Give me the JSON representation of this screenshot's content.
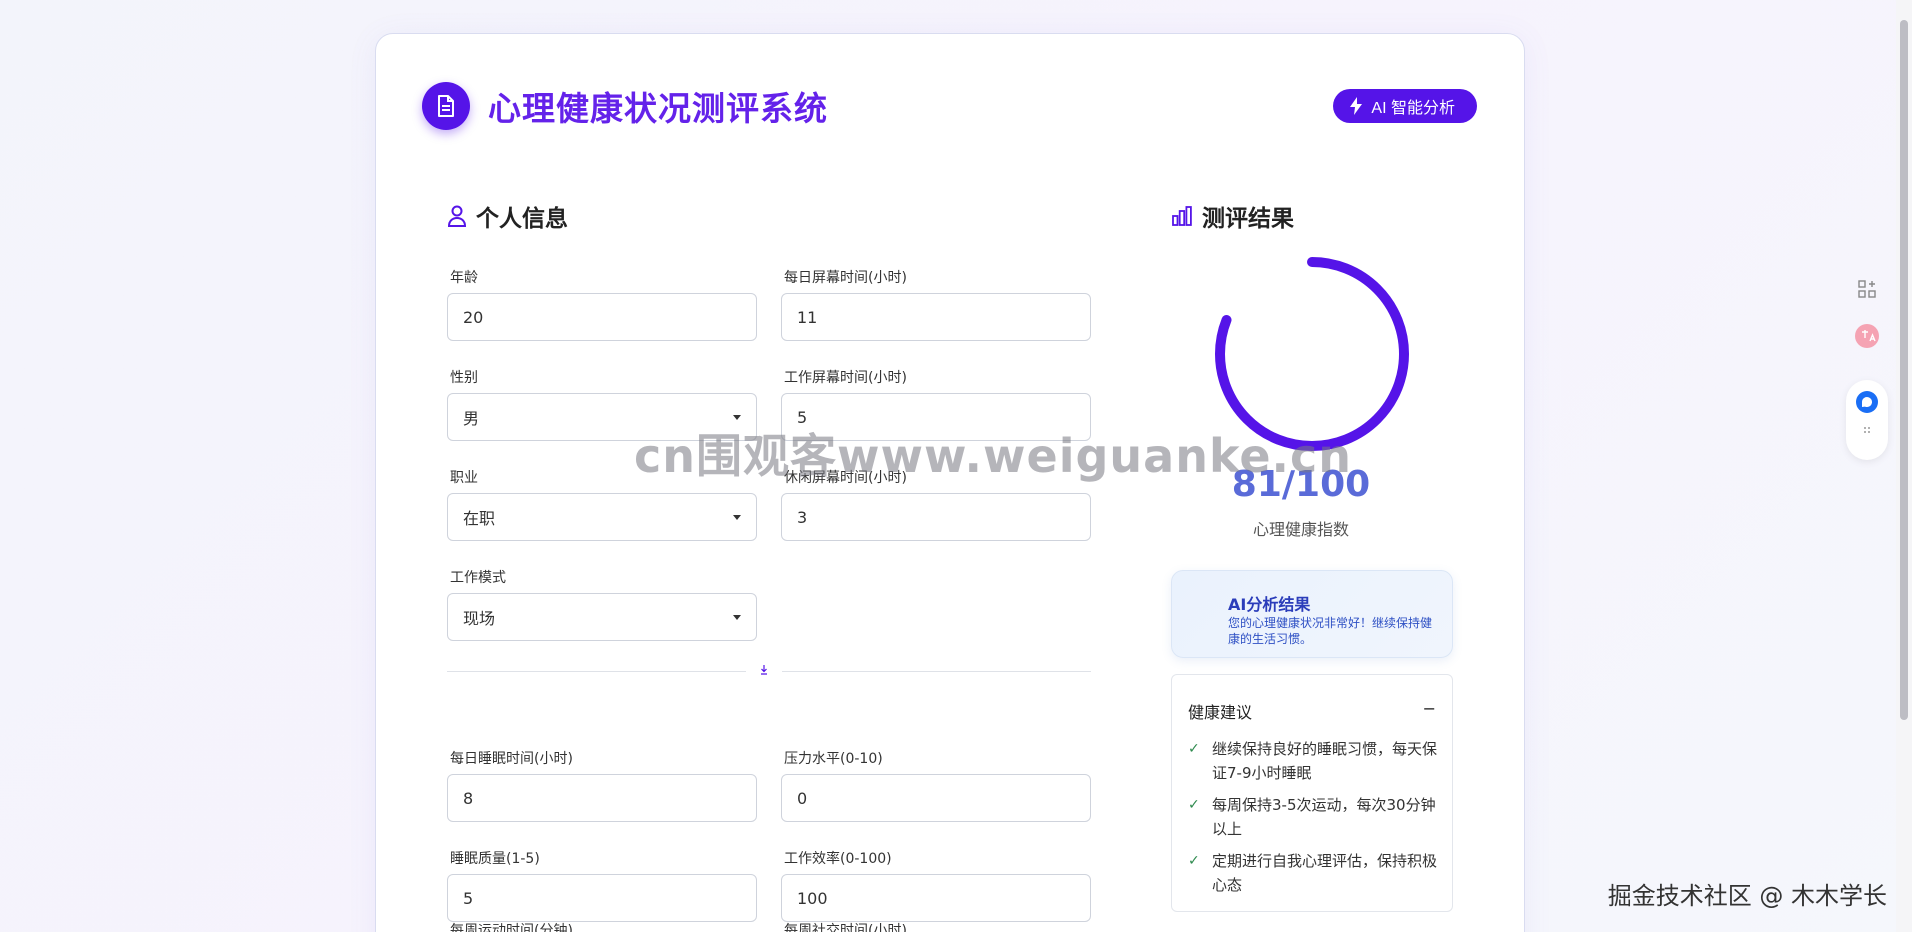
{
  "header": {
    "title": "心理健康状况测评系统",
    "ai_button_label": "AI 智能分析"
  },
  "personal_section": {
    "title": "个人信息",
    "age": {
      "label": "年龄",
      "value": "20"
    },
    "daily_screen": {
      "label": "每日屏幕时间(小时)",
      "value": "11"
    },
    "gender": {
      "label": "性别",
      "value": "男"
    },
    "work_screen": {
      "label": "工作屏幕时间(小时)",
      "value": "5"
    },
    "occupation": {
      "label": "职业",
      "value": "在职"
    },
    "leisure_screen": {
      "label": "休闲屏幕时间(小时)",
      "value": "3"
    },
    "work_mode": {
      "label": "工作模式",
      "value": "现场"
    },
    "sleep_hours": {
      "label": "每日睡眠时间(小时)",
      "value": "8"
    },
    "stress": {
      "label": "压力水平(0-10)",
      "value": "0"
    },
    "sleep_quality": {
      "label": "睡眠质量(1-5)",
      "value": "5"
    },
    "efficiency": {
      "label": "工作效率(0-100)",
      "value": "100"
    },
    "exercise": {
      "label": "每周运动时间(分钟)"
    },
    "social": {
      "label": "每周社交时间(小时)"
    }
  },
  "result_section": {
    "title": "测评结果",
    "score": 81,
    "score_max": 100,
    "score_text": "81/100",
    "score_label": "心理健康指数",
    "gauge_color": "#5514e8",
    "ai_result_title": "AI分析结果",
    "ai_result_text": "您的心理健康状况非常好！继续保持健康的生活习惯。",
    "tips_title": "健康建议",
    "tips_toggle": "−",
    "tips": [
      "继续保持良好的睡眠习惯，每天保证7-9小时睡眠",
      "每周保持3-5次运动，每次30分钟以上",
      "定期进行自我心理评估，保持积极心态"
    ]
  },
  "overlay": {
    "watermark": "cn围观客www.weiguanke.cn",
    "corner_mark": "掘金技术社区 @ 木木学长"
  },
  "icons": {
    "logo": "document-icon",
    "ai": "lightning-icon",
    "personal": "user-icon",
    "result": "bar-chart-icon",
    "tip": "check-icon"
  }
}
